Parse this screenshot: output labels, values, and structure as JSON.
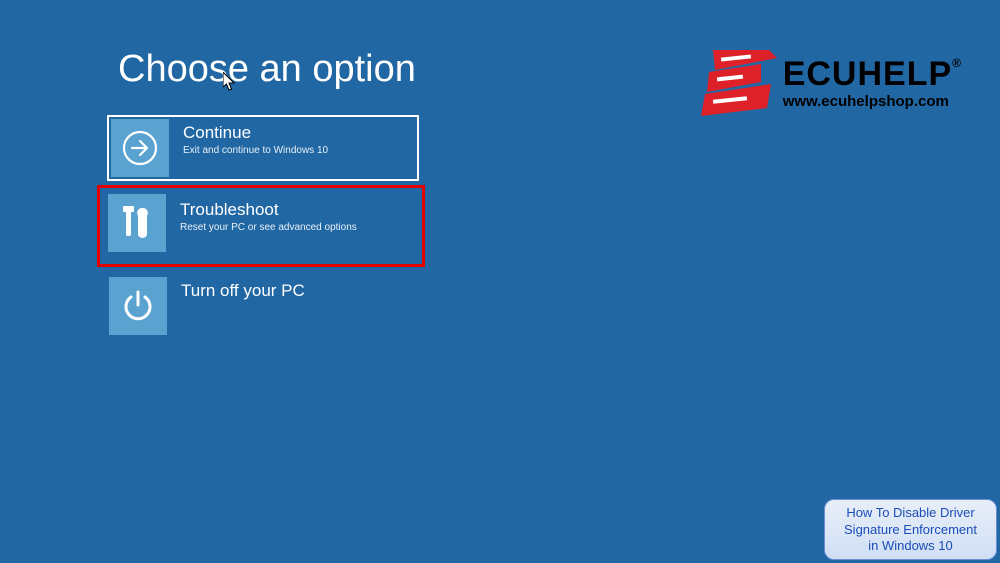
{
  "page": {
    "title": "Choose an option"
  },
  "options": {
    "continue": {
      "title": "Continue",
      "subtitle": "Exit and continue to Windows 10"
    },
    "troubleshoot": {
      "title": "Troubleshoot",
      "subtitle": "Reset your PC or see advanced options"
    },
    "turnoff": {
      "title": "Turn off your PC"
    }
  },
  "branding": {
    "logo_text": "ECUHELP",
    "logo_url": "www.ecuhelpshop.com"
  },
  "banner": {
    "line1": "How To Disable Driver",
    "line2": "Signature Enforcement",
    "line3": "in Windows 10"
  }
}
